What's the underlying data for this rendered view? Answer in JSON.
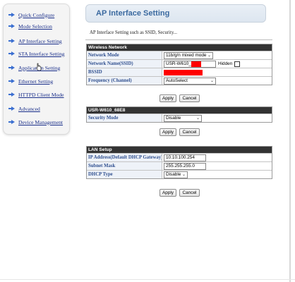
{
  "sidebar": {
    "items": [
      {
        "label": "Quick Configure"
      },
      {
        "label": "Mode Selection"
      },
      {
        "label": "AP Interface Setting"
      },
      {
        "label": "STA Interface Setting"
      },
      {
        "label": "Application Setting"
      },
      {
        "label": "Ethernet Setting"
      },
      {
        "label": "HTTPD Client Mode"
      },
      {
        "label": "Advanced"
      },
      {
        "label": "Device Management"
      }
    ]
  },
  "header": {
    "title": "AP Interface Setting",
    "description": "AP Interface Setting such as SSID, Security..."
  },
  "wireless": {
    "heading": "Wireless Network",
    "network_mode_label": "Network Mode",
    "network_mode_value": "11b/g/n mixed mode",
    "ssid_label": "Network Name(SSID)",
    "ssid_value": "USR-W610_",
    "hidden_label": "Hidden",
    "bssid_label": "BSSID",
    "frequency_label": "Frequency (Channel)",
    "frequency_value": "AutoSelect",
    "apply_label": "Apply",
    "cancel_label": "Cancel"
  },
  "security": {
    "heading": "USR-W610_68E8",
    "mode_label": "Security Mode",
    "mode_value": "Disable",
    "apply_label": "Apply",
    "cancel_label": "Cancel"
  },
  "lan": {
    "heading": "LAN Setup",
    "ip_label": "IP Address(Default DHCP Gateway)",
    "ip_value": "10.10.100.254",
    "mask_label": "Subnet Mask",
    "mask_value": "255.255.255.0",
    "dhcp_label": "DHCP Type",
    "dhcp_value": "Disable",
    "apply_label": "Apply",
    "cancel_label": "Cancel"
  },
  "colors": {
    "accent": "#3b6aa0",
    "section_header": "#333333",
    "redaction": "#ff0000",
    "link": "#1a2f8a"
  }
}
